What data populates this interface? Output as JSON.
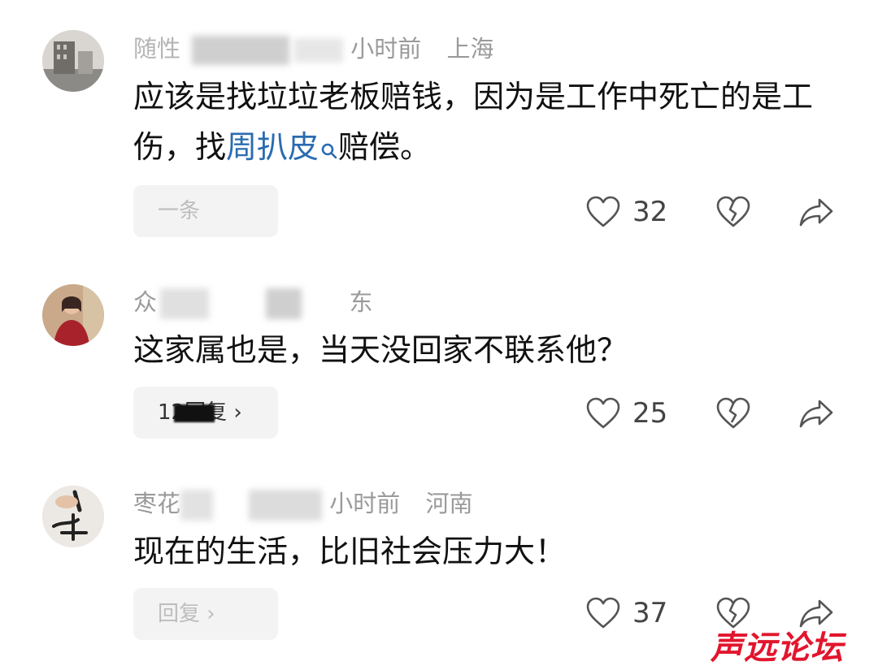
{
  "comments": [
    {
      "user": "随性",
      "time": "小时前",
      "location": "上海",
      "text_before": "应该是找垃垃老板赔钱，因为是工作中死亡的是工伤，找",
      "mention": "周扒皮",
      "text_after": "赔偿。",
      "reply_label": "一条",
      "likes": "32"
    },
    {
      "user": "众",
      "time": "",
      "location": "东",
      "text": "这家属也是，当天没回家不联系他？",
      "reply_label": "12回复 ›",
      "likes": "25"
    },
    {
      "user": "枣花",
      "time": "小时前",
      "location": "河南",
      "text": "现在的生活，比旧社会压力大！",
      "reply_label": "回复 ›",
      "likes": "37"
    }
  ],
  "watermark": "声远论坛",
  "colors": {
    "mention": "#2a6bb0",
    "watermark": "#e2152d"
  }
}
